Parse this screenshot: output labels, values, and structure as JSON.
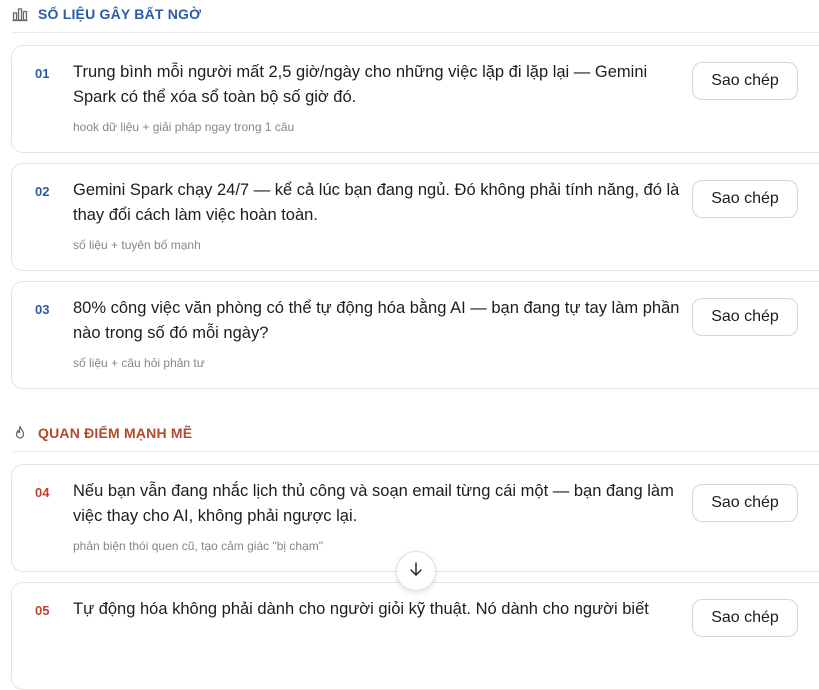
{
  "sections": [
    {
      "icon": "bar-chart-icon",
      "title": "SỐ LIỆU GÂY BẤT NGỜ",
      "color": "#2a5aa8"
    },
    {
      "icon": "flame-icon",
      "title": "QUAN ĐIỂM MẠNH MẼ",
      "color": "#b5482c"
    }
  ],
  "copy_label": "Sao chép",
  "items": [
    {
      "num": "01",
      "text": "Trung bình mỗi người mất 2,5 giờ/ngày cho những việc lặp đi lặp lại — Gemini Spark có thể xóa sổ toàn bộ số giờ đó.",
      "tag": "hook dữ liệu + giải pháp ngay trong 1 câu"
    },
    {
      "num": "02",
      "text": "Gemini Spark chạy 24/7 — kể cả lúc bạn đang ngủ. Đó không phải tính năng, đó là thay đổi cách làm việc hoàn toàn.",
      "tag": "số liệu + tuyên bố mạnh"
    },
    {
      "num": "03",
      "text": "80% công việc văn phòng có thể tự động hóa bằng AI — bạn đang tự tay làm phần nào trong số đó mỗi ngày?",
      "tag": "số liệu + câu hỏi phản tư"
    },
    {
      "num": "04",
      "text": "Nếu bạn vẫn đang nhắc lịch thủ công và soạn email từng cái một — bạn đang làm việc thay cho AI, không phải ngược lại.",
      "tag": "phản biện thói quen cũ, tạo cảm giác \"bị chạm\""
    },
    {
      "num": "05",
      "text": "Tự động hóa không phải dành cho người giỏi kỹ thuật. Nó dành cho người biết",
      "tag": ""
    }
  ]
}
